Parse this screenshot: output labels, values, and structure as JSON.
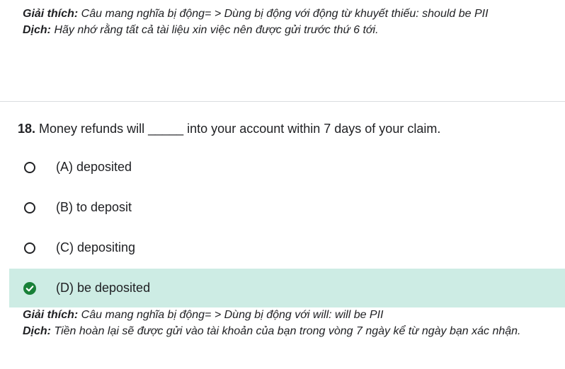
{
  "previous": {
    "explain_label": "Giải thích:",
    "explain_text": " Câu mang nghĩa bị động= > Dùng bị động với động từ khuyết thiếu: should be PII",
    "translate_label": "Dịch:",
    "translate_text": " Hãy nhớ rằng tất cả tài liệu xin việc nên được gửi trước thứ 6 tới."
  },
  "question": {
    "number": "18.",
    "text": " Money refunds will _____ into your account within 7 days of your claim.",
    "options": [
      {
        "label": "(A) deposited",
        "state": "unselected"
      },
      {
        "label": "(B) to deposit",
        "state": "unselected"
      },
      {
        "label": "(C) depositing",
        "state": "unselected"
      },
      {
        "label": "(D) be deposited",
        "state": "correct"
      }
    ],
    "explain_label": "Giải thích:",
    "explain_text": " Câu mang nghĩa bị động= > Dùng bị động với will: will be PII",
    "translate_label": "Dịch:",
    "translate_text": " Tiền hoàn lại sẽ được gửi vào tài khoản của bạn trong vòng 7 ngày kể từ ngày bạn xác nhận."
  },
  "icons": {
    "radio": "radio-empty-icon",
    "correct": "check-circle-icon"
  },
  "colors": {
    "correct_bg": "#cdece4",
    "check_green": "#188038",
    "divider": "#dadce0"
  }
}
